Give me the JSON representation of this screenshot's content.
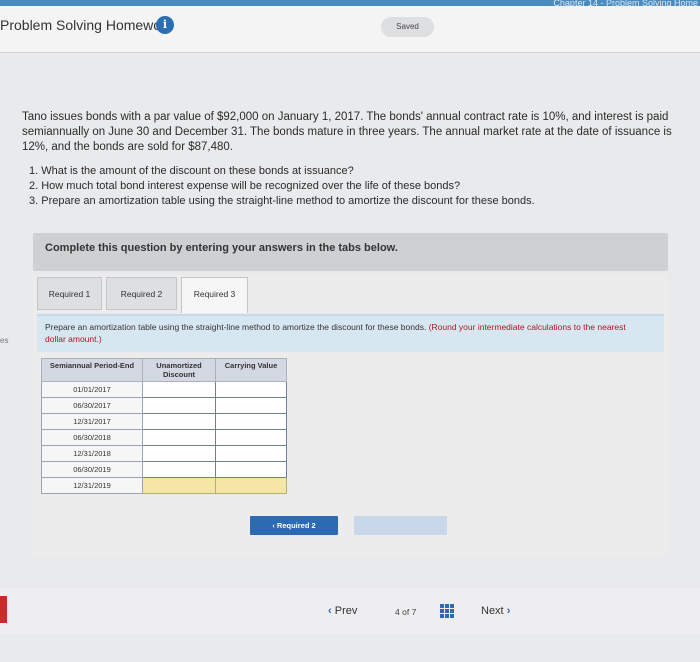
{
  "topbar": {
    "breadcrumb": "Chapter 14 - Problem Solving Home"
  },
  "header": {
    "title": "Problem Solving Homework",
    "status": "Saved"
  },
  "question": {
    "paragraph": "Tano issues bonds with a par value of $92,000 on January 1, 2017. The bonds' annual contract rate is 10%, and interest is paid semiannually on June 30 and December 31. The bonds mature in three years. The annual market rate at the date of issuance is 12%, and the bonds are sold for $87,480.",
    "steps": [
      "1. What is the amount of the discount on these bonds at issuance?",
      "2. How much total bond interest expense will be recognized over the life of these bonds?",
      "3. Prepare an amortization table using the straight-line method to amortize the discount for these bonds."
    ]
  },
  "complete_instructions": "Complete this question by entering your answers in the tabs below.",
  "tabs": [
    {
      "label": "Required 1"
    },
    {
      "label": "Required 2"
    },
    {
      "label": "Required 3"
    }
  ],
  "instructions": {
    "main": "Prepare an amortization table using the straight-line method to amortize the discount for these bonds.",
    "note": "(Round your intermediate calculations to the nearest dollar amount.)"
  },
  "side_label": "es",
  "table": {
    "headers": [
      "Semiannual Period-End",
      "Unamortized Discount",
      "Carrying Value"
    ],
    "rows": [
      "01/01/2017",
      "06/30/2017",
      "12/31/2017",
      "06/30/2018",
      "12/31/2018",
      "06/30/2019",
      "12/31/2019"
    ]
  },
  "buttons": {
    "prev_required": "Required 2"
  },
  "nav": {
    "prev": "Prev",
    "page": "4",
    "of": "of",
    "total": "7",
    "next": "Next"
  },
  "colors": {
    "accent": "#2c6ab3",
    "input_highlight": "#f5e6a6",
    "instruction_bg": "#d7e7f2"
  }
}
